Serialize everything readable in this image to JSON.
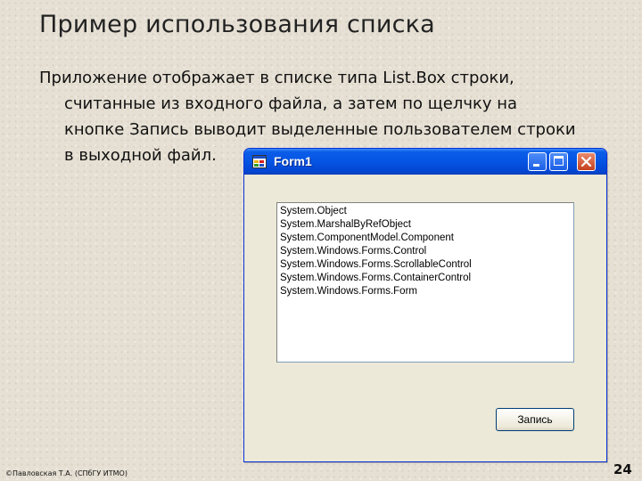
{
  "slide": {
    "title": "Пример использования списка",
    "body_lines": [
      "Приложение отображает в списке типа List.Box строки,",
      "считанные из входного файла, а затем по щелчку на",
      "кнопке Запись выводит выделенные пользователем строки",
      "в выходной файл."
    ],
    "footer": "©Павловская Т.А. (СПбГУ ИТМО)",
    "page_number": "24"
  },
  "window": {
    "title": "Form1",
    "icons": [
      "app-form-icon",
      "minimize-icon",
      "maximize-icon",
      "close-icon"
    ],
    "listbox_items": [
      "System.Object",
      "System.MarshalByRefObject",
      "System.ComponentModel.Component",
      "System.Windows.Forms.Control",
      "System.Windows.Forms.ScrollableControl",
      "System.Windows.Forms.ContainerControl",
      "System.Windows.Forms.Form"
    ],
    "button_label": "Запись"
  },
  "colors": {
    "titlebar": "#0554e3",
    "window_face": "#ece9d8",
    "close_button": "#c4401d"
  }
}
